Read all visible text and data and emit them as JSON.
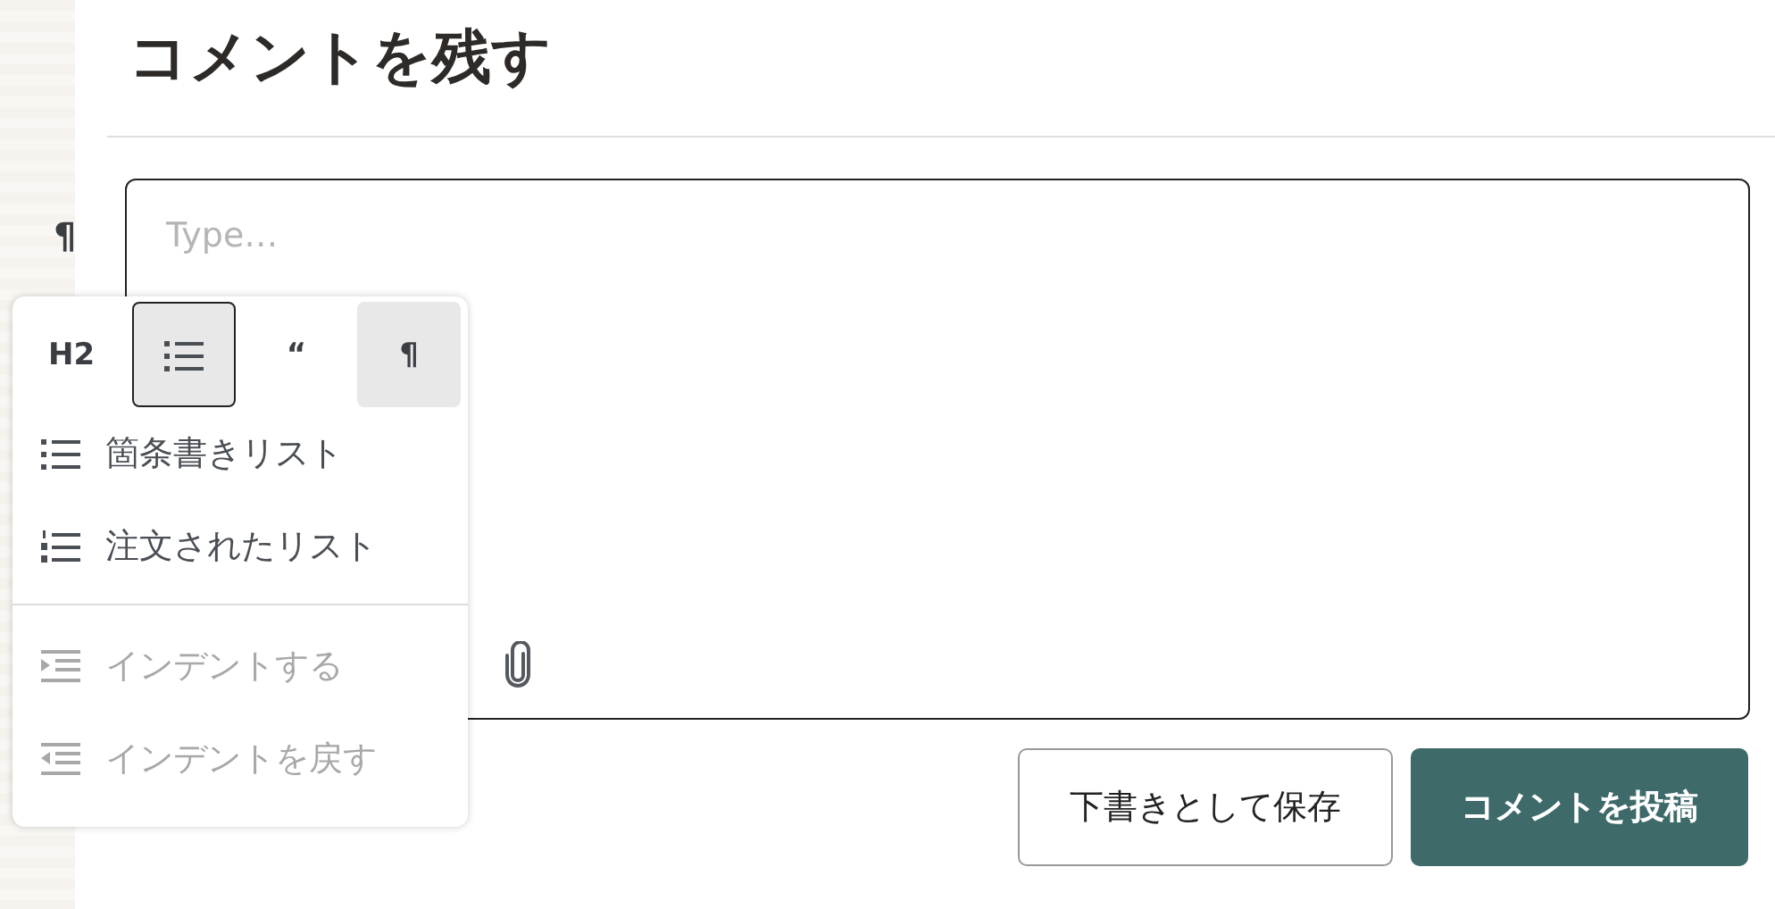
{
  "heading": "コメントを残す",
  "block_marker": "¶",
  "editor": {
    "placeholder": "Type…"
  },
  "popup": {
    "tools": [
      {
        "kind": "text",
        "label": "H2",
        "selected": false,
        "focused": false
      },
      {
        "kind": "list",
        "selected": true,
        "focused": true
      },
      {
        "kind": "text",
        "label": "“",
        "selected": false,
        "focused": false
      },
      {
        "kind": "text",
        "label": "¶",
        "selected": true,
        "focused": false
      }
    ],
    "items": [
      {
        "kind": "bullet",
        "label": "箇条書きリスト",
        "disabled": false
      },
      {
        "kind": "numbered",
        "label": "注文されたリスト",
        "disabled": false
      },
      {
        "kind": "indent",
        "label": "インデントする",
        "disabled": true
      },
      {
        "kind": "outdent",
        "label": "インデントを戻す",
        "disabled": true
      }
    ]
  },
  "buttons": [
    {
      "kind": "secondary",
      "label": "下書きとして保存"
    },
    {
      "kind": "primary",
      "label": "コメントを投稿"
    }
  ]
}
